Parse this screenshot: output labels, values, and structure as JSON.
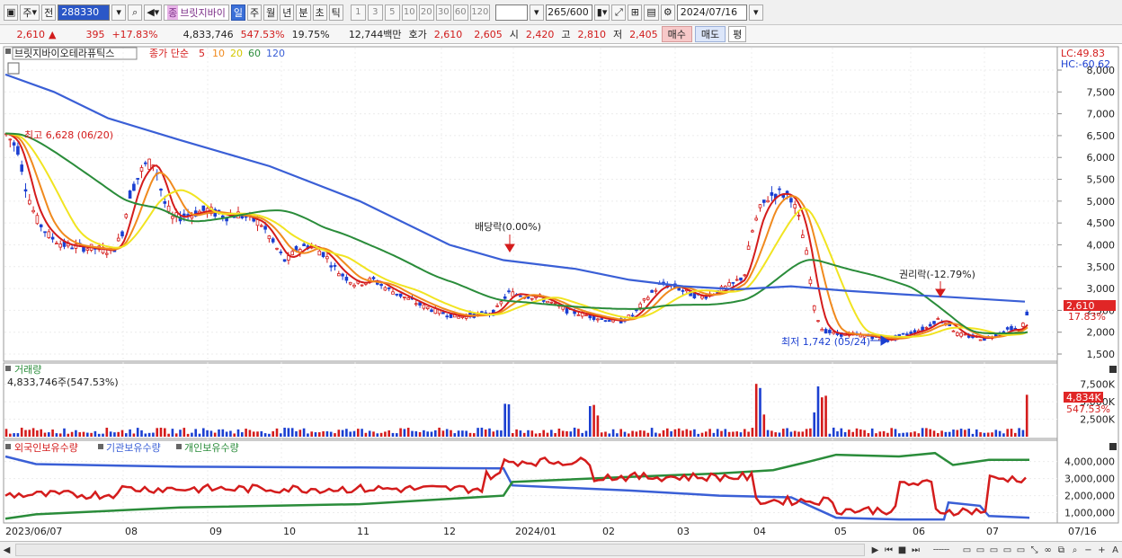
{
  "toolbar": {
    "period_label": "주",
    "prev_label": "전",
    "stock_code": "288330",
    "stock_name": "브릿지바이",
    "name_prefix": "종",
    "period_buttons": [
      "일",
      "주",
      "월",
      "년",
      "분",
      "초",
      "틱"
    ],
    "active_period": "일",
    "interval_buttons": [
      "1",
      "3",
      "5",
      "10",
      "20",
      "30",
      "60",
      "120"
    ],
    "count_value": "265",
    "count_max": "/600",
    "date_value": "2024/07/16"
  },
  "quote": {
    "price": "2,610",
    "arrow": "▲",
    "change": "395",
    "change_pct": "+17.83%",
    "volume": "4,833,746",
    "volume_ratio": "547.53%",
    "turnover": "19.75%",
    "amount": "12,744백만",
    "ask_label": "호가",
    "ask1": "2,610",
    "ask2": "2,605",
    "open_label": "시",
    "open": "2,420",
    "high_label": "고",
    "high": "2,810",
    "low_label": "저",
    "low": "2,405",
    "buy_label": "매수",
    "sell_label": "매도",
    "eval_label": "평"
  },
  "price_panel": {
    "stock_title": "브릿지바이오테라퓨틱스",
    "ma_label": "종가 단순",
    "ma_periods": [
      "5",
      "10",
      "20",
      "60",
      "120"
    ],
    "lc_label": "LC:49.83",
    "hc_label": "HC:-60.62",
    "y_ticks": [
      "8,000",
      "7,500",
      "7,000",
      "6,500",
      "6,000",
      "5,500",
      "5,000",
      "4,500",
      "4,000",
      "3,500",
      "3,000",
      "2,500",
      "2,000",
      "1,500"
    ],
    "current_price_tag": "2,610",
    "current_pct_tag": "17.83%",
    "annotations": {
      "high": "최고 6,628 (06/20)",
      "dividend": "배당락(0.00%)",
      "rights": "권리락(-12.79%)",
      "low": "최저 1,742 (05/24)"
    }
  },
  "volume_panel": {
    "title": "거래량",
    "value_label": "4,833,746주(547.53%)",
    "y_ticks": [
      "7,500K",
      "5,000K",
      "2,500K"
    ],
    "current_tag": "4,834K",
    "current_pct": "547.53%"
  },
  "holdings_panel": {
    "labels": [
      "외국인보유수량",
      "기관보유수량",
      "개인보유수량"
    ],
    "y_ticks": [
      "4,000,000",
      "3,000,000",
      "2,000,000",
      "1,000,000"
    ]
  },
  "x_axis": {
    "labels": [
      "2023/06/07",
      "08",
      "09",
      "10",
      "11",
      "12",
      "2024/01",
      "02",
      "03",
      "04",
      "05",
      "06",
      "07",
      "07/16"
    ]
  },
  "colors": {
    "ma5": "#d41c1c",
    "ma10": "#f08a1e",
    "ma20": "#f1e421",
    "ma60": "#2a8c3a",
    "ma120": "#3a5fd6",
    "up": "#d41c1c",
    "down": "#1b3fd1",
    "foreign": "#d41c1c",
    "institution": "#3a5fd6",
    "individual": "#2a8c3a"
  }
}
